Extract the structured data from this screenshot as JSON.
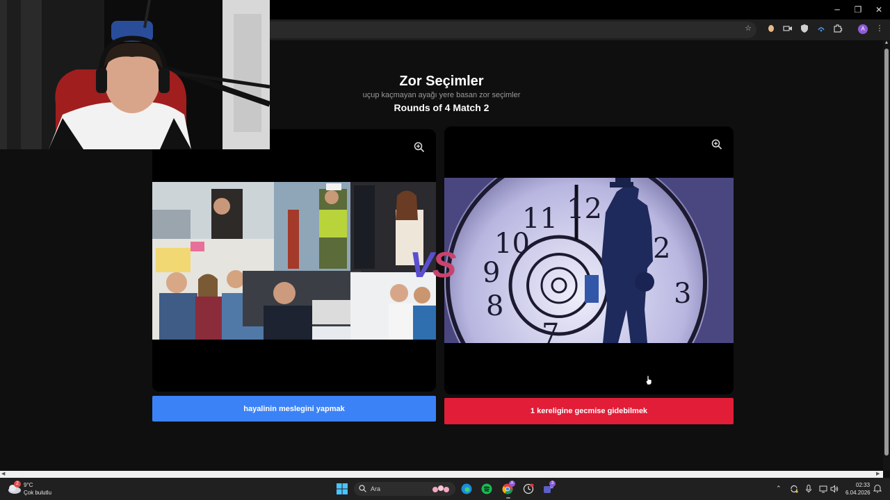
{
  "browser": {
    "window_controls": {
      "minimize": "─",
      "restore": "❐",
      "close": "✕"
    },
    "toolbar_icons": [
      "star-icon",
      "extension-icon",
      "camera-icon",
      "shield-icon",
      "wifi-icon",
      "puzzle-icon",
      "profile-icon",
      "menu-icon"
    ],
    "profile_initial": "A"
  },
  "page": {
    "title": "Zor Seçimler",
    "subtitle": "uçup kaçmayan ayağı yere basan zor seçimler",
    "rounds": "Rounds of 4 Match 2",
    "vs_v": "V",
    "vs_s": "S",
    "left_choice": {
      "label": "hayalinin meslegini yapmak",
      "color": "#3b82f6",
      "image": "collage of people working in various jobs"
    },
    "right_choice": {
      "label": "1 kereligine gecmise gidebilmek",
      "color": "#e11d38",
      "image": "man walking into a spiral clock face"
    }
  },
  "taskbar": {
    "weather_temp": "9°C",
    "weather_desc": "Çok bulutlu",
    "weather_badge": "2",
    "search_placeholder": "Ara",
    "time": "02:33",
    "date": "6.04.2026",
    "chrome_badge": "A",
    "teams_badge": "3"
  }
}
